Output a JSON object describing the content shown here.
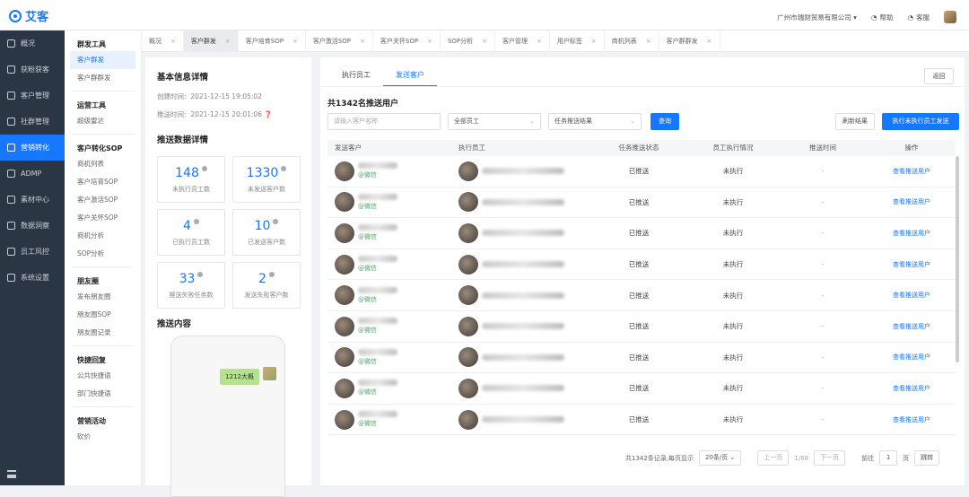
{
  "app": {
    "name": "艾客"
  },
  "header": {
    "company": "广州市瑞财贸易有限公司 ▾",
    "help": "帮助",
    "feedback": "客服"
  },
  "nav": {
    "items": [
      {
        "label": "概况",
        "active": false
      },
      {
        "label": "获粉获客",
        "active": false
      },
      {
        "label": "客户管理",
        "active": false
      },
      {
        "label": "社群管理",
        "active": false
      },
      {
        "label": "营销转化",
        "active": true
      },
      {
        "label": "ADMP",
        "active": false
      },
      {
        "label": "素材中心",
        "active": false
      },
      {
        "label": "数据洞察",
        "active": false
      },
      {
        "label": "员工风控",
        "active": false
      },
      {
        "label": "系统设置",
        "active": false
      }
    ]
  },
  "subnav": {
    "groups": [
      {
        "title": "群发工具",
        "items": [
          {
            "label": "客户群发",
            "active": true
          },
          {
            "label": "客户群群发",
            "active": false
          }
        ]
      },
      {
        "title": "运营工具",
        "items": [
          {
            "label": "超级雷达",
            "active": false
          }
        ]
      },
      {
        "title": "客户转化SOP",
        "items": [
          {
            "label": "商机列表",
            "active": false
          },
          {
            "label": "客户培育SOP",
            "active": false
          },
          {
            "label": "客户激活SOP",
            "active": false
          },
          {
            "label": "客户关怀SOP",
            "active": false
          },
          {
            "label": "商机分析",
            "active": false
          },
          {
            "label": "SOP分析",
            "active": false
          }
        ]
      },
      {
        "title": "朋友圈",
        "items": [
          {
            "label": "发布朋友圈",
            "active": false
          },
          {
            "label": "朋友圈SOP",
            "active": false
          },
          {
            "label": "朋友圈记录",
            "active": false
          }
        ]
      },
      {
        "title": "快捷回复",
        "items": [
          {
            "label": "公共快捷语",
            "active": false
          },
          {
            "label": "部门快捷语",
            "active": false
          }
        ]
      },
      {
        "title": "营销活动",
        "items": [
          {
            "label": "砍价",
            "active": false
          }
        ]
      }
    ]
  },
  "tabs": [
    {
      "label": "概况",
      "active": false
    },
    {
      "label": "客户群发",
      "active": true
    },
    {
      "label": "客户培育SOP",
      "active": false
    },
    {
      "label": "客户激活SOP",
      "active": false
    },
    {
      "label": "客户关怀SOP",
      "active": false
    },
    {
      "label": "SOP分析",
      "active": false
    },
    {
      "label": "客户管理",
      "active": false
    },
    {
      "label": "用户标签",
      "active": false
    },
    {
      "label": "商机列表",
      "active": false
    },
    {
      "label": "客户群群发",
      "active": false
    }
  ],
  "tab_close": "×",
  "basic": {
    "title": "基本信息详情",
    "created_label": "创建时间:",
    "created": "2021-12-15 19:05:02",
    "push_label": "推送时间:",
    "push": "2021-12-15 20:01:06"
  },
  "stats": {
    "title": "推送数据详情",
    "items": [
      {
        "num": "148",
        "label": "未执行员工数"
      },
      {
        "num": "1330",
        "label": "未发送客户数"
      },
      {
        "num": "4",
        "label": "已执行员工数"
      },
      {
        "num": "10",
        "label": "已发送客户数"
      },
      {
        "num": "33",
        "label": "推送失败任务数"
      },
      {
        "num": "2",
        "label": "发送失败客户数"
      }
    ]
  },
  "content": {
    "title": "推送内容",
    "bubble": "1212大概"
  },
  "detail": {
    "tabs": [
      {
        "label": "执行员工",
        "active": false
      },
      {
        "label": "发送客户",
        "active": true
      }
    ],
    "back": "返回",
    "count_title": "共1342名推送用户",
    "filters": {
      "name_placeholder": "请输入客户名称",
      "staff": "全部员工",
      "status": "任务推送结果",
      "query": "查询",
      "refresh": "刷新结果",
      "push": "执行未执行员工发送"
    },
    "columns": [
      "发送客户",
      "执行员工",
      "任务推送状态",
      "员工执行情况",
      "推送时间",
      "操作"
    ],
    "rows": [
      {
        "customer_tag": "@微信",
        "status": "已推送",
        "exec": "未执行",
        "time": "-",
        "op": "查看推送用户"
      },
      {
        "customer_tag": "@微信",
        "status": "已推送",
        "exec": "未执行",
        "time": "-",
        "op": "查看推送用户"
      },
      {
        "customer_tag": "@微信",
        "status": "已推送",
        "exec": "未执行",
        "time": "-",
        "op": "查看推送用户"
      },
      {
        "customer_tag": "@微信",
        "status": "已推送",
        "exec": "未执行",
        "time": "-",
        "op": "查看推送用户"
      },
      {
        "customer_tag": "@微信",
        "status": "已推送",
        "exec": "未执行",
        "time": "-",
        "op": "查看推送用户"
      },
      {
        "customer_tag": "@微信",
        "status": "已推送",
        "exec": "未执行",
        "time": "-",
        "op": "查看推送用户"
      },
      {
        "customer_tag": "@微信",
        "status": "已推送",
        "exec": "未执行",
        "time": "-",
        "op": "查看推送用户"
      },
      {
        "customer_tag": "@微信",
        "status": "已推送",
        "exec": "未执行",
        "time": "-",
        "op": "查看推送用户"
      },
      {
        "customer_tag": "@微信",
        "status": "已推送",
        "exec": "未执行",
        "time": "-",
        "op": "查看推送用户"
      }
    ],
    "pager": {
      "summary": "共1342条记录,每页显示",
      "size": "20条/页",
      "prev": "上一页",
      "page": "1/68",
      "next": "下一页",
      "goto": "前往",
      "goto_val": "1",
      "unit": "页",
      "jump": "跳转"
    }
  }
}
